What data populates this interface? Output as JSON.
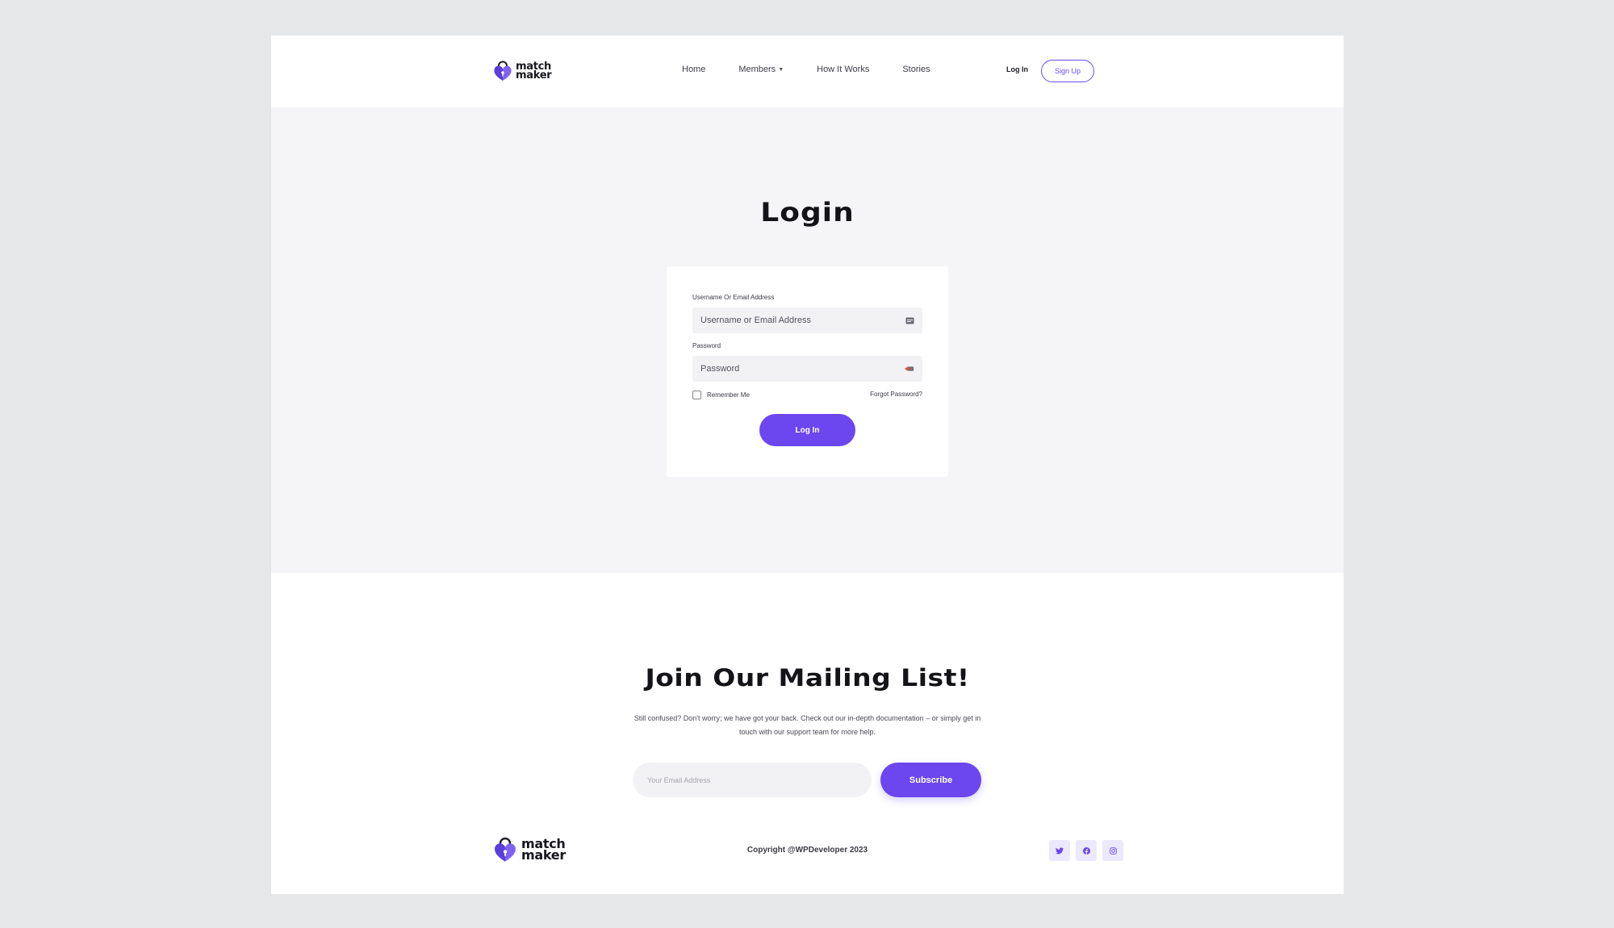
{
  "brand": {
    "name_line1": "match",
    "name_line2": "maker",
    "accent_color": "#6c46ee"
  },
  "header": {
    "nav": [
      {
        "label": "Home",
        "has_dropdown": false
      },
      {
        "label": "Members",
        "has_dropdown": true
      },
      {
        "label": "How It Works",
        "has_dropdown": false
      },
      {
        "label": "Stories",
        "has_dropdown": false
      }
    ],
    "login_label": "Log In",
    "signup_label": "Sign Up"
  },
  "login": {
    "title": "Login",
    "username_label": "Username Or Email Address",
    "username_placeholder": "Username or Email Address",
    "username_value": "",
    "username_icon": "id-card-icon",
    "password_label": "Password",
    "password_placeholder": "Password",
    "password_value": "",
    "password_icon": "key-icon",
    "remember_label": "Remember Me",
    "remember_checked": false,
    "forgot_label": "Forgot Password?",
    "submit_label": "Log In"
  },
  "mailing": {
    "title": "Join Our Mailing List!",
    "description": "Still confused? Don't worry; we have got your back. Check out our in-depth documentation – or simply get in touch with our support team for more help.",
    "email_placeholder": "Your Email Address",
    "email_value": "",
    "subscribe_label": "Subscribe"
  },
  "footer": {
    "copyright": "Copyright @WPDeveloper 2023",
    "socials": [
      "twitter-icon",
      "facebook-icon",
      "instagram-icon"
    ]
  }
}
